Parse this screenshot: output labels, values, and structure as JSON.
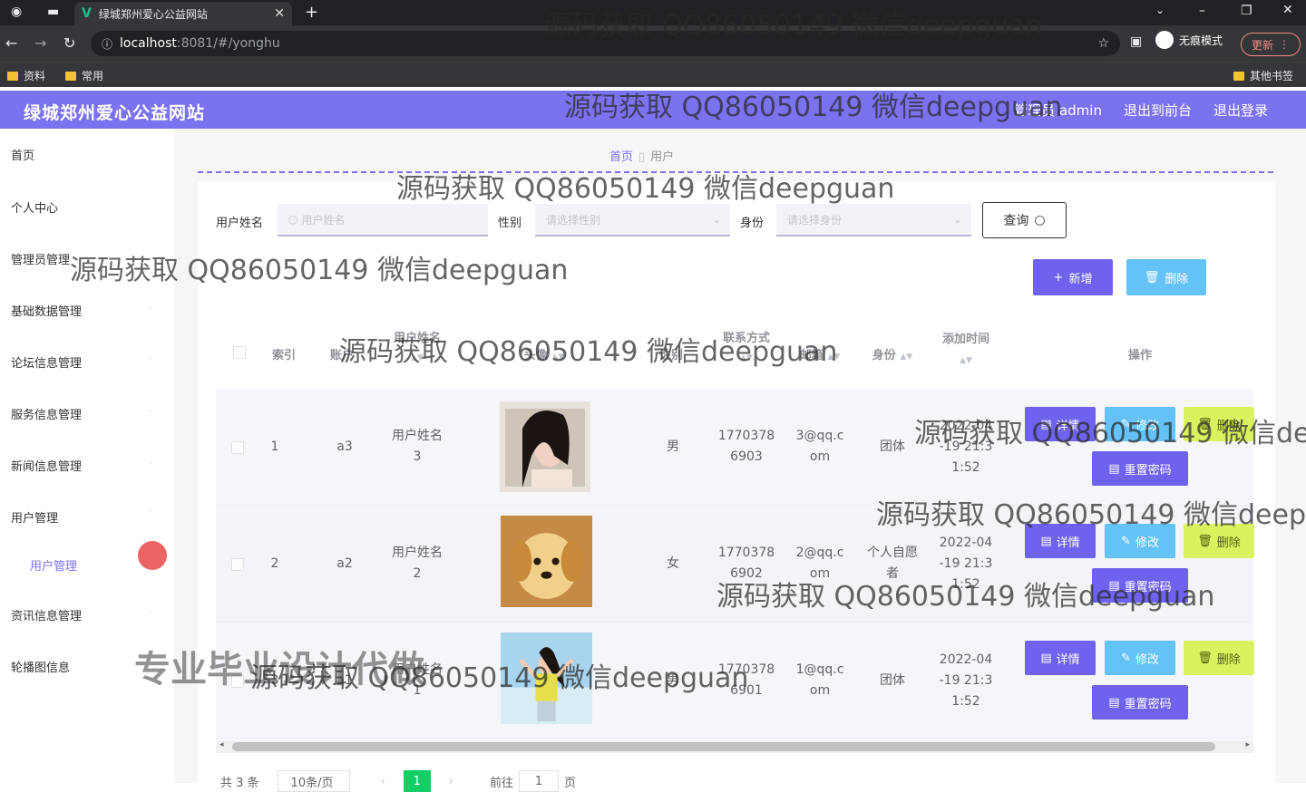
{
  "browser": {
    "tab_title": "绿城郑州爱心公益网站",
    "url_host": "localhost",
    "url_path": ":8081/#/yonghu",
    "incognito_label": "无痕模式",
    "update_label": "更新",
    "bookmarks": [
      "资料",
      "常用"
    ],
    "other_bookmarks": "其他书签"
  },
  "header": {
    "title": "绿城郑州爱心公益网站",
    "user": "管理员 admin",
    "to_front": "退出到前台",
    "logout": "退出登录"
  },
  "sidebar": {
    "items": [
      "首页",
      "个人中心",
      "管理员管理",
      "基础数据管理",
      "论坛信息管理",
      "服务信息管理",
      "新闻信息管理",
      "用户管理",
      "资讯信息管理",
      "轮播图信息"
    ],
    "sub_item": "用户管理"
  },
  "breadcrumb": {
    "home": "首页",
    "current": "用户"
  },
  "search": {
    "name_label": "用户姓名",
    "name_placeholder": "用户姓名",
    "gender_label": "性别",
    "gender_placeholder": "请选择性别",
    "identity_label": "身份",
    "identity_placeholder": "请选择身份",
    "query_label": "查询"
  },
  "actions": {
    "add": "新增",
    "delete": "删除"
  },
  "table": {
    "headers": [
      "索引",
      "账户",
      "用户姓名",
      "头像",
      "性别",
      "联系方式",
      "邮箱",
      "身份",
      "添加时间",
      "操作"
    ],
    "rows": [
      {
        "index": "1",
        "account": "a3",
        "name": [
          "用户姓名",
          "3"
        ],
        "gender": "男",
        "phone": [
          "1770378",
          "6903"
        ],
        "email": [
          "3@qq.c",
          "om"
        ],
        "identity": [
          "团体"
        ],
        "time": [
          "2022-04",
          "-19 21:3",
          "1:52"
        ]
      },
      {
        "index": "2",
        "account": "a2",
        "name": [
          "用户姓名",
          "2"
        ],
        "gender": "女",
        "phone": [
          "1770378",
          "6902"
        ],
        "email": [
          "2@qq.c",
          "om"
        ],
        "identity": [
          "个人自愿",
          "者"
        ],
        "time": [
          "2022-04",
          "-19 21:3",
          "1:52"
        ]
      },
      {
        "index": "3",
        "account": "a1",
        "name": [
          "用户姓名",
          "1"
        ],
        "gender": "男",
        "phone": [
          "1770378",
          "6901"
        ],
        "email": [
          "1@qq.c",
          "om"
        ],
        "identity": [
          "团体"
        ],
        "time": [
          "2022-04",
          "-19 21:3",
          "1:52"
        ]
      }
    ],
    "buttons": {
      "detail": "详情",
      "edit": "修改",
      "delete": "删除",
      "reset": "重置密码"
    }
  },
  "pagination": {
    "total": "共 3 条",
    "page_size": "10条/页",
    "current": "1",
    "goto": "前往",
    "goto_value": "1",
    "page_unit": "页"
  },
  "watermark": {
    "text": "源码获取 QQ86050149 微信deepguan",
    "promo": "专业毕业设计代做"
  },
  "colors": {
    "accent": "#7b72f0",
    "edit": "#64c2f7",
    "delete": "#d9f25f",
    "page_active": "#13ce66"
  }
}
